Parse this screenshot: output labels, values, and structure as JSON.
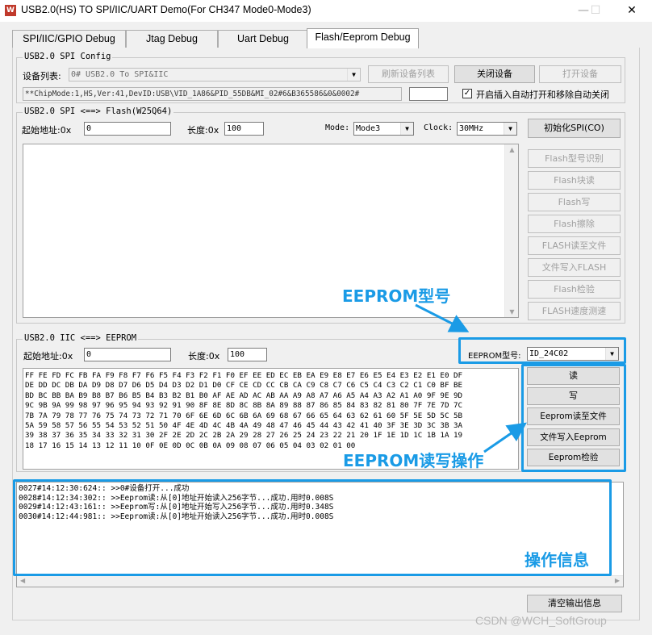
{
  "window": {
    "title": "USB2.0(HS) TO SPI/IIC/UART Demo(For CH347 Mode0-Mode3)",
    "app_icon": "W",
    "minimize": "—",
    "maximize": "☐",
    "close": "✕"
  },
  "tabs": [
    {
      "label": "SPI/IIC/GPIO Debug"
    },
    {
      "label": "Jtag Debug"
    },
    {
      "label": "Uart Debug"
    },
    {
      "label": "Flash/Eeprom Debug",
      "active": true
    }
  ],
  "spi_config": {
    "group_label": "USB2.0 SPI Config",
    "device_list_label": "设备列表:",
    "device_selected": "0# USB2.0 To SPI&IIC",
    "refresh_button": "刷新设备列表",
    "close_device_button": "关闭设备",
    "open_device_button": "打开设备",
    "chip_info": "**ChipMode:1,HS,Ver:41,DevID:USB\\VID_1A86&PID_55DB&MI_02#6&B365586&0&0002#",
    "extra_field": "",
    "auto_open_checked": true,
    "auto_open_label": "开启插入自动打开和移除自动关闭"
  },
  "spi_flash": {
    "group_label": "USB2.0 SPI <==> Flash(W25Q64)",
    "start_addr_label": "起始地址:0x",
    "start_addr": "0",
    "length_label": "长度:0x",
    "length": "100",
    "mode_label": "Mode:",
    "mode": "Mode3",
    "clock_label": "Clock:",
    "clock": "30MHz",
    "init_button": "初始化SPI(CO)",
    "buttons": [
      "Flash型号识别",
      "Flash块读",
      "Flash写",
      "Flash擦除",
      "FLASH读至文件",
      "文件写入FLASH",
      "Flash检验",
      "FLASH速度测速"
    ]
  },
  "iic_eeprom": {
    "group_label": "USB2.0 IIC <==> EEPROM",
    "start_addr_label": "起始地址:0x",
    "start_addr": "0",
    "length_label": "长度:0x",
    "length": "100",
    "eeprom_type_label": "EEPROM型号:",
    "eeprom_type": "ID_24C02",
    "read_button": "读",
    "write_button": "写",
    "read_to_file_button": "Eeprom读至文件",
    "file_write_button": "文件写入Eeprom",
    "verify_button": "Eeprom检验",
    "hex_lines": [
      "FF FE FD FC FB FA F9 F8 F7 F6 F5 F4 F3 F2 F1 F0 EF EE ED EC EB EA E9 E8 E7 E6 E5 E4 E3 E2 E1 E0 DF",
      "DE DD DC DB DA D9 D8 D7 D6 D5 D4 D3 D2 D1 D0 CF CE CD CC CB CA C9 C8 C7 C6 C5 C4 C3 C2 C1 C0 BF BE",
      "BD BC BB BA B9 B8 B7 B6 B5 B4 B3 B2 B1 B0 AF AE AD AC AB AA A9 A8 A7 A6 A5 A4 A3 A2 A1 A0 9F 9E 9D",
      "9C 9B 9A 99 98 97 96 95 94 93 92 91 90 8F 8E 8D 8C 8B 8A 89 88 87 86 85 84 83 82 81 80 7F 7E 7D 7C",
      "7B 7A 79 78 77 76 75 74 73 72 71 70 6F 6E 6D 6C 6B 6A 69 68 67 66 65 64 63 62 61 60 5F 5E 5D 5C 5B",
      "5A 59 58 57 56 55 54 53 52 51 50 4F 4E 4D 4C 4B 4A 49 48 47 46 45 44 43 42 41 40 3F 3E 3D 3C 3B 3A",
      "39 38 37 36 35 34 33 32 31 30 2F 2E 2D 2C 2B 2A 29 28 27 26 25 24 23 22 21 20 1F 1E 1D 1C 1B 1A 19",
      "18 17 16 15 14 13 12 11 10 0F 0E 0D 0C 0B 0A 09 08 07 06 05 04 03 02 01 00"
    ]
  },
  "log": {
    "lines": [
      "0027#14:12:30:624:: >>0#设备打开...成功",
      "0028#14:12:34:302:: >>Eeprom读:从[0]地址开始读入256字节...成功.用时0.008S",
      "0029#14:12:43:161:: >>Eeprom写:从[0]地址开始写入256字节...成功.用时0.348S",
      "0030#14:12:44:981:: >>Eeprom读:从[0]地址开始读入256字节...成功.用时0.008S"
    ],
    "clear_button": "清空输出信息"
  },
  "annotations": {
    "eeprom_model": "EEPROM型号",
    "eeprom_rw": "EEPROM读写操作",
    "operation_info": "操作信息",
    "color": "#1a9be6"
  },
  "watermark": "CSDN @WCH_SoftGroup"
}
